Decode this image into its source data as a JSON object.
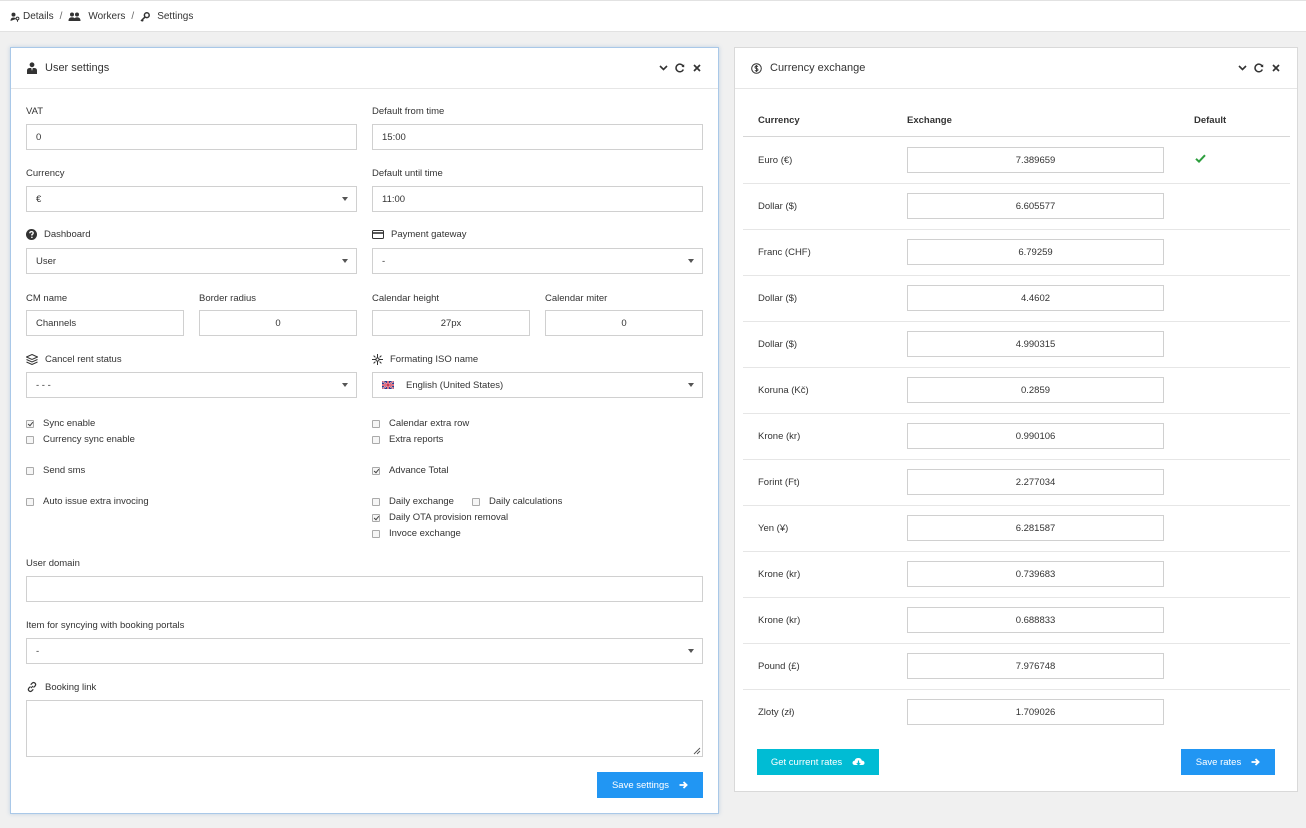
{
  "breadcrumb": {
    "items": [
      {
        "label": "Details",
        "icon": "user-key-icon"
      },
      {
        "label": "Workers",
        "icon": "users-icon"
      },
      {
        "label": "Settings",
        "icon": "key-icon"
      }
    ],
    "separator": "/"
  },
  "user_settings": {
    "title": "User settings",
    "vat": {
      "label": "VAT",
      "value": "0"
    },
    "default_from_time": {
      "label": "Default from time",
      "value": "15:00"
    },
    "currency": {
      "label": "Currency",
      "value": "€"
    },
    "default_until_time": {
      "label": "Default until time",
      "value": "11:00"
    },
    "dashboard": {
      "label": "Dashboard",
      "value": "User"
    },
    "payment_gateway": {
      "label": "Payment gateway",
      "value": "-"
    },
    "cm_name": {
      "label": "CM name",
      "value": "Channels"
    },
    "border_radius": {
      "label": "Border radius",
      "value": "0"
    },
    "calendar_height": {
      "label": "Calendar height",
      "value": "27px"
    },
    "calendar_miter": {
      "label": "Calendar miter",
      "value": "0"
    },
    "cancel_rent_status": {
      "label": "Cancel rent status",
      "value": "- - -"
    },
    "formating_iso_name": {
      "label": "Formating ISO name",
      "value": "English (United States)"
    },
    "checkboxes": {
      "sync_enable": {
        "label": "Sync enable",
        "checked": true
      },
      "currency_sync_enable": {
        "label": "Currency sync enable",
        "checked": false
      },
      "send_sms": {
        "label": "Send sms",
        "checked": false
      },
      "auto_issue_extra_invoicing": {
        "label": "Auto issue extra invocing",
        "checked": false
      },
      "calendar_extra_row": {
        "label": "Calendar extra row",
        "checked": false
      },
      "extra_reports": {
        "label": "Extra reports",
        "checked": false
      },
      "advance_total": {
        "label": "Advance Total",
        "checked": true
      },
      "daily_exchange": {
        "label": "Daily exchange",
        "checked": false
      },
      "daily_calculations": {
        "label": "Daily calculations",
        "checked": false
      },
      "daily_ota_provision_removal": {
        "label": "Daily OTA provision removal",
        "checked": true
      },
      "invoce_exchange": {
        "label": "Invoce exchange",
        "checked": false
      }
    },
    "user_domain": {
      "label": "User domain",
      "value": ""
    },
    "booking_portal_item": {
      "label": "Item for syncying with booking portals",
      "value": "-"
    },
    "booking_link": {
      "label": "Booking link",
      "value": ""
    },
    "save_label": "Save settings"
  },
  "currency_exchange": {
    "title": "Currency exchange",
    "columns": [
      "Currency",
      "Exchange",
      "Default"
    ],
    "rows": [
      {
        "currency": "Euro (€)",
        "rate": "7.389659",
        "default": true
      },
      {
        "currency": "Dollar ($)",
        "rate": "6.605577",
        "default": false
      },
      {
        "currency": "Franc (CHF)",
        "rate": "6.79259",
        "default": false
      },
      {
        "currency": "Dollar ($)",
        "rate": "4.4602",
        "default": false
      },
      {
        "currency": "Dollar ($)",
        "rate": "4.990315",
        "default": false
      },
      {
        "currency": "Koruna (Kč)",
        "rate": "0.2859",
        "default": false
      },
      {
        "currency": "Krone (kr)",
        "rate": "0.990106",
        "default": false
      },
      {
        "currency": "Forint (Ft)",
        "rate": "2.277034",
        "default": false
      },
      {
        "currency": "Yen (¥)",
        "rate": "6.281587",
        "default": false
      },
      {
        "currency": "Krone (kr)",
        "rate": "0.739683",
        "default": false
      },
      {
        "currency": "Krone (kr)",
        "rate": "0.688833",
        "default": false
      },
      {
        "currency": "Pound (£)",
        "rate": "7.976748",
        "default": false
      },
      {
        "currency": "Zloty (zł)",
        "rate": "1.709026",
        "default": false
      }
    ],
    "get_rates_label": "Get current rates",
    "save_rates_label": "Save rates"
  },
  "colors": {
    "primary": "#2196f3",
    "info": "#00bcd4",
    "success": "#2e9e3e"
  }
}
